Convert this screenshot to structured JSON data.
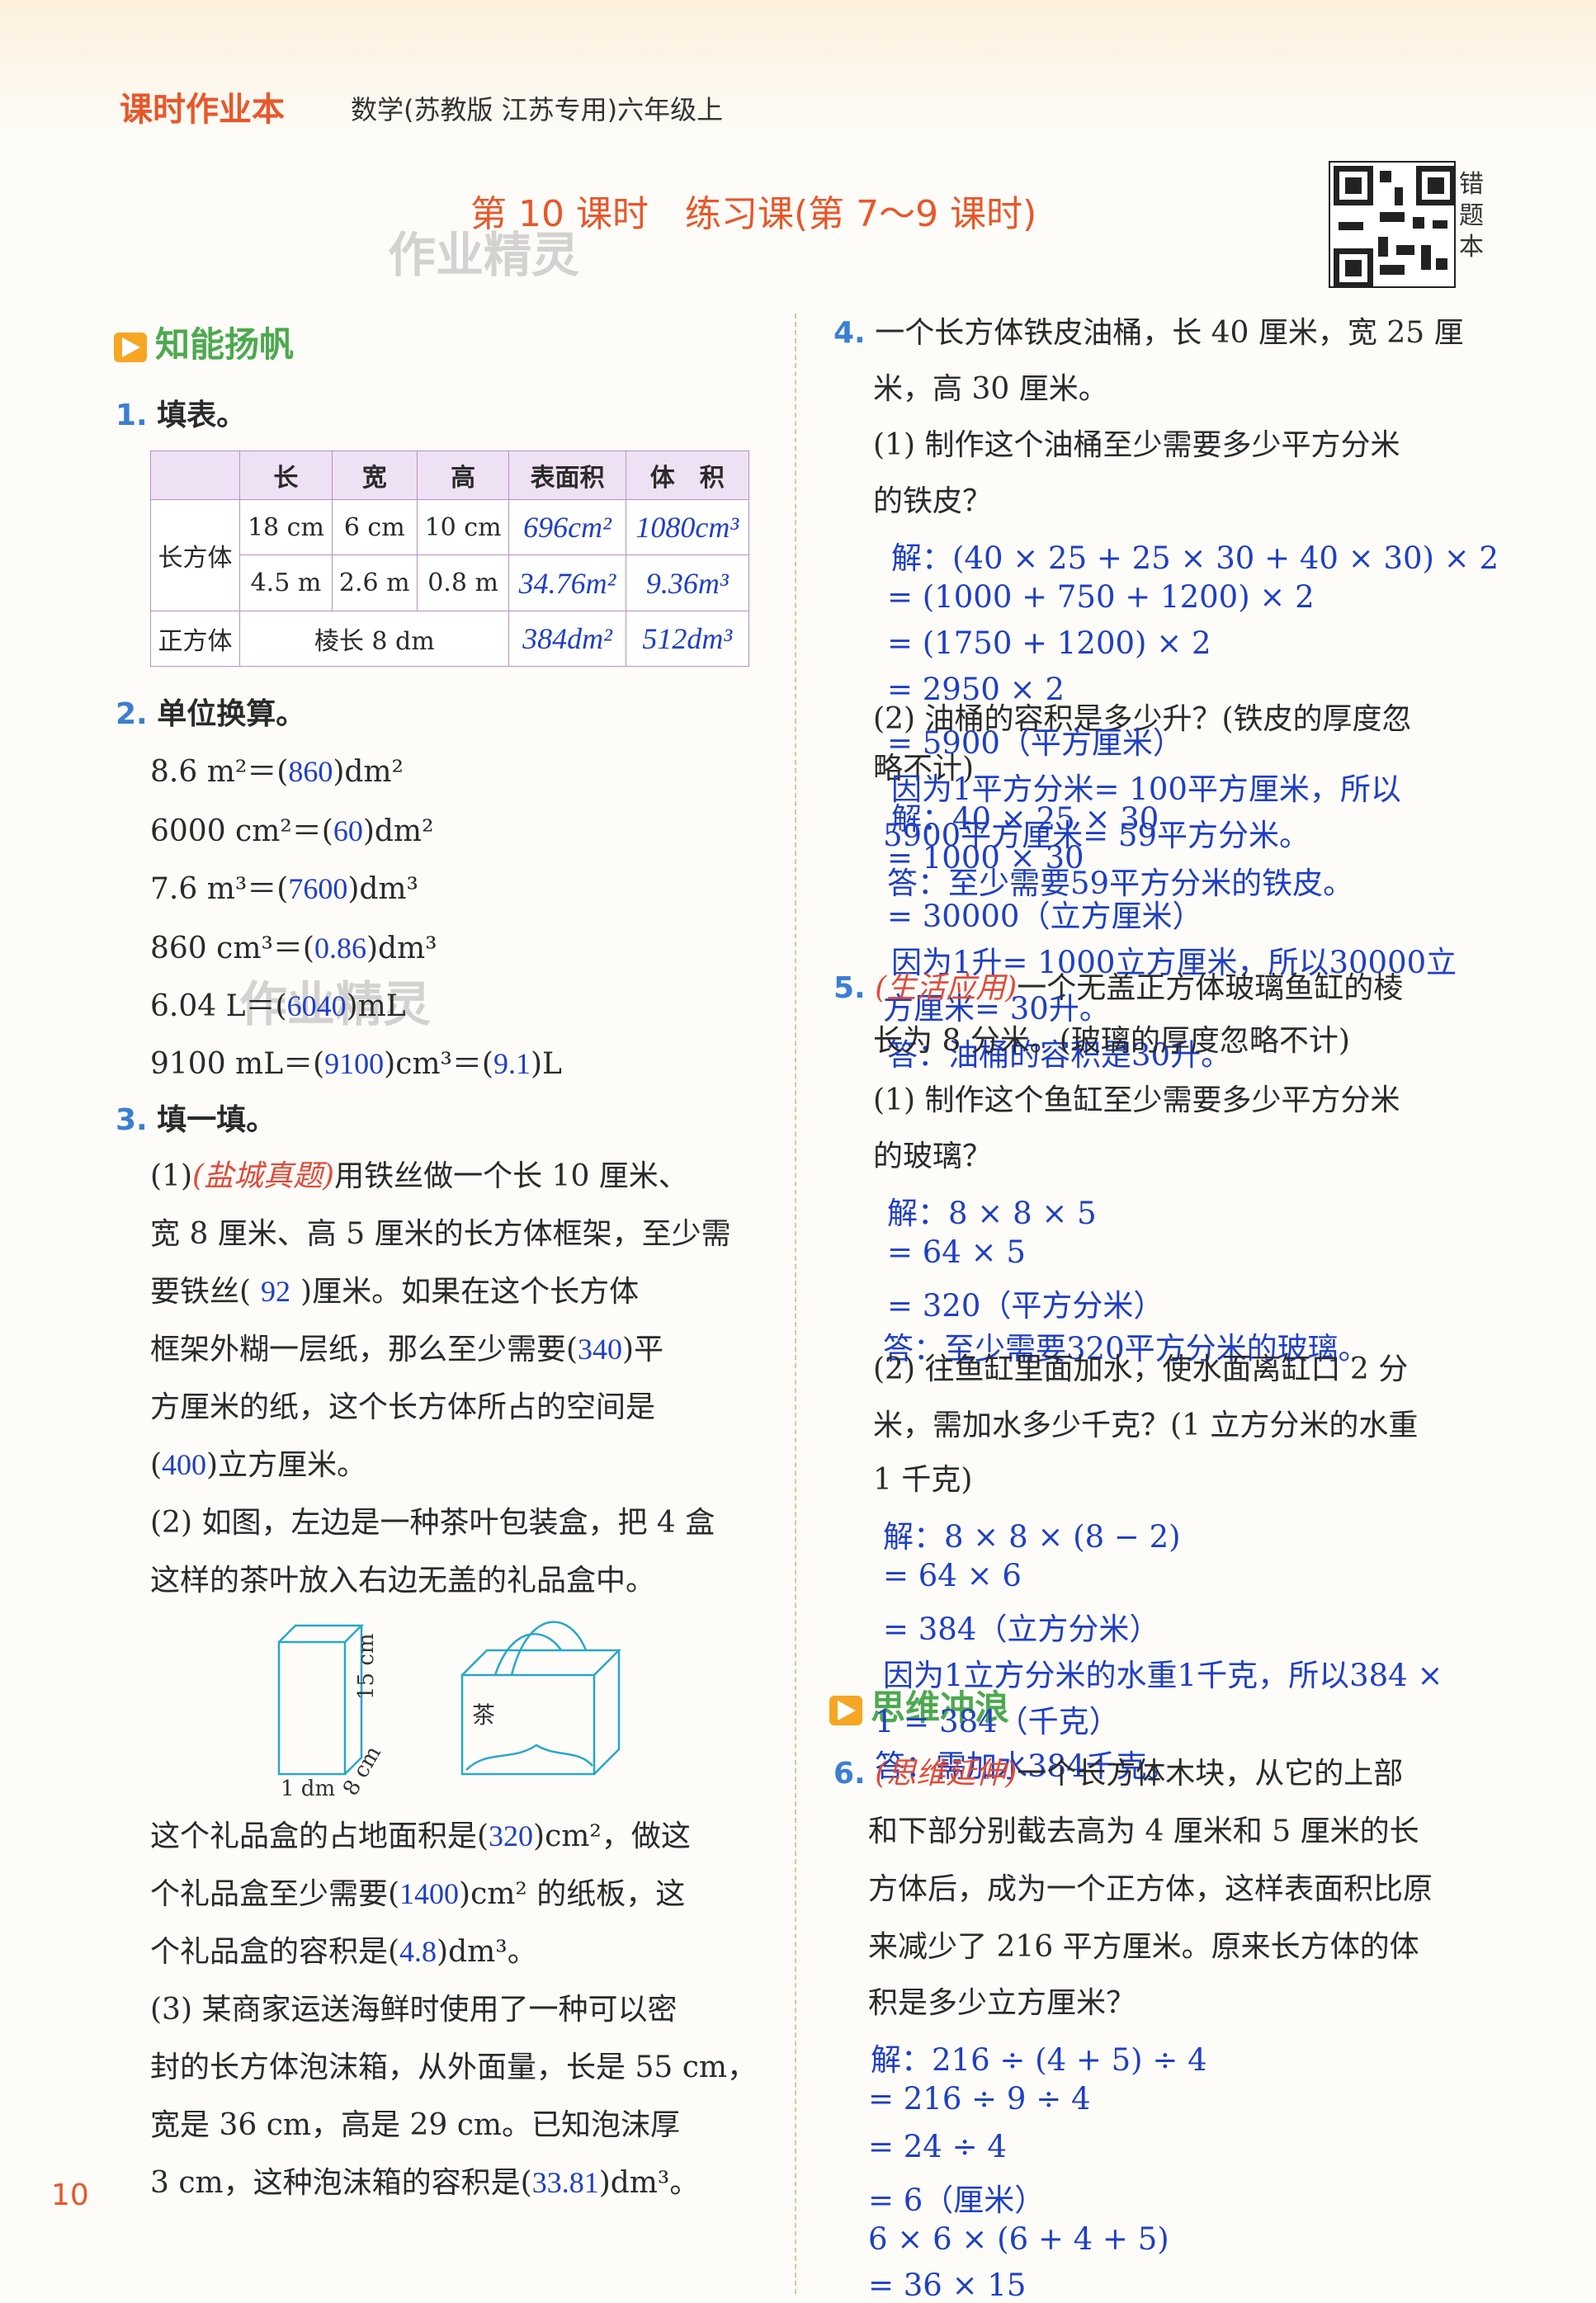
{
  "header": {
    "brand": "课时作业本",
    "subject": "数学(苏教版 江苏专用)六年级上",
    "lesson_title": "第 10 课时　练习课(第 7～9 课时)",
    "watermark": "作业精灵",
    "error_book": "错题本"
  },
  "section1": {
    "title": "知能扬帆"
  },
  "q1": {
    "num": "1.",
    "title": "填表。",
    "headers": [
      "",
      "长",
      "宽",
      "高",
      "表面积",
      "体　积"
    ],
    "rows": [
      {
        "label": "长方体",
        "cells": [
          "18 cm",
          "6 cm",
          "10 cm"
        ],
        "answers": [
          "696cm²",
          "1080cm³"
        ]
      },
      {
        "label": "",
        "cells": [
          "4.5 m",
          "2.6 m",
          "0.8 m"
        ],
        "answers": [
          "34.76m²",
          "9.36m³"
        ]
      },
      {
        "label": "正方体",
        "span": "棱长 8 dm",
        "answers": [
          "384dm²",
          "512dm³"
        ]
      }
    ]
  },
  "q2": {
    "num": "2.",
    "title": "单位换算。",
    "items": [
      {
        "pre": "8.6 m²＝(",
        "ans": "860",
        "post": ")dm²"
      },
      {
        "pre": "6000 cm²＝(",
        "ans": "60",
        "post": ")dm²"
      },
      {
        "pre": "7.6 m³＝(",
        "ans": "7600",
        "post": ")dm³"
      },
      {
        "pre": "860 cm³＝(",
        "ans": "0.86",
        "post": ")dm³"
      },
      {
        "pre": "6.04 L＝(",
        "ans": "6040",
        "post": ")mL"
      },
      {
        "pre": "9100 mL＝(",
        "ans": "9100",
        "mid": ")cm³＝(",
        "ans2": "9.1",
        "post": ")L"
      }
    ]
  },
  "q3": {
    "num": "3.",
    "title": "填一填。",
    "p1_tag": "(盐城真题)",
    "p1_lines": [
      "(1)",
      "用铁丝做一个长 10 厘米、",
      "宽 8 厘米、高 5 厘米的长方体框架，至少需",
      "要铁丝(",
      ")厘米。如果在这个长方体",
      "框架外糊一层纸，那么至少需要(",
      ")平",
      "方厘米的纸，这个长方体所占的空间是",
      "(",
      ")立方厘米。"
    ],
    "p1_answers": [
      "92",
      "340",
      "400"
    ],
    "p2_lines": [
      "(2) 如图，左边是一种茶叶包装盒，把 4 盒",
      "这样的茶叶放入右边无盖的礼品盒中。"
    ],
    "fig_labels": {
      "h": "15 cm",
      "w": "1 dm",
      "d": "8 cm",
      "tea": "茶"
    },
    "p2_fill": [
      "这个礼品盒的占地面积是(",
      ")cm²，做这",
      "个礼品盒至少需要(",
      ")cm² 的纸板，这",
      "个礼品盒的容积是(",
      ")dm³。"
    ],
    "p2_answers": [
      "320",
      "1400",
      "4.8"
    ],
    "p3_lines": [
      "(3) 某商家运送海鲜时使用了一种可以密",
      "封的长方体泡沫箱，从外面量，长是 55 cm，",
      "宽是 36 cm，高是 29 cm。已知泡沫厚",
      "3 cm，这种泡沫箱的容积是(",
      ")dm³。"
    ],
    "p3_answer": "33.81"
  },
  "q4": {
    "num": "4.",
    "lines": [
      "一个长方体铁皮油桶，长 40 厘米，宽 25 厘",
      "米，高 30 厘米。",
      "(1) 制作这个油桶至少需要多少平方分米",
      "的铁皮？"
    ],
    "sol1": [
      "解：(40 × 25 + 25 × 30 + 40 × 30) × 2",
      "= (1000 + 750 + 1200) × 2",
      "= (1750 + 1200) × 2",
      "= 2950 × 2",
      "= 5900（平方厘米）",
      "因为1平方分米= 100平方厘米，所以",
      "5900平方厘米= 59平方分米。",
      "答：至少需要59平方分米的铁皮。"
    ],
    "q2_lines": [
      "(2) 油桶的容积是多少升？(铁皮的厚度忽",
      "略不计)"
    ],
    "sol2": [
      "解：40 × 25 × 30",
      "= 1000 × 30",
      "= 30000（立方厘米）",
      "因为1升= 1000立方厘米，所以30000立",
      "方厘米= 30升。",
      "答：油桶的容积是30升。"
    ]
  },
  "q5": {
    "num": "5.",
    "tag": "(生活应用)",
    "lines": [
      "一个无盖正方体玻璃鱼缸的棱",
      "长为 8 分米。(玻璃的厚度忽略不计)",
      "(1) 制作这个鱼缸至少需要多少平方分米",
      "的玻璃？"
    ],
    "sol1": [
      "解：8 × 8 × 5",
      "= 64 × 5",
      "= 320（平方分米）",
      "答：至少需要320平方分米的玻璃。"
    ],
    "q2_lines": [
      "(2) 往鱼缸里面加水，使水面离缸口 2 分",
      "米，需加水多少千克？(1 立方分米的水重",
      "1 千克)"
    ],
    "sol2": [
      "解：8 × 8 × (8 − 2)",
      "= 64 × 6",
      "= 384（立方分米）",
      "因为1立方分米的水重1千克，所以384 ×",
      "1 = 384（千克）",
      "答：需加水384千克。"
    ]
  },
  "section2": {
    "title": "思维冲浪"
  },
  "q6": {
    "num": "6.",
    "tag": "(思维延伸)",
    "lines": [
      "一个长方体木块，从它的上部",
      "和下部分别截去高为 4 厘米和 5 厘米的长",
      "方体后，成为一个正方体，这样表面积比原",
      "来减少了 216 平方厘米。原来长方体的体",
      "积是多少立方厘米？"
    ],
    "sol": [
      "解：216 ÷ (4 + 5) ÷ 4",
      "= 216 ÷ 9 ÷ 4",
      "= 24 ÷ 4",
      "= 6（厘米）",
      "6 × 6 × (6 + 4 + 5)",
      "= 36 × 15"
    ]
  },
  "page_number": "10"
}
